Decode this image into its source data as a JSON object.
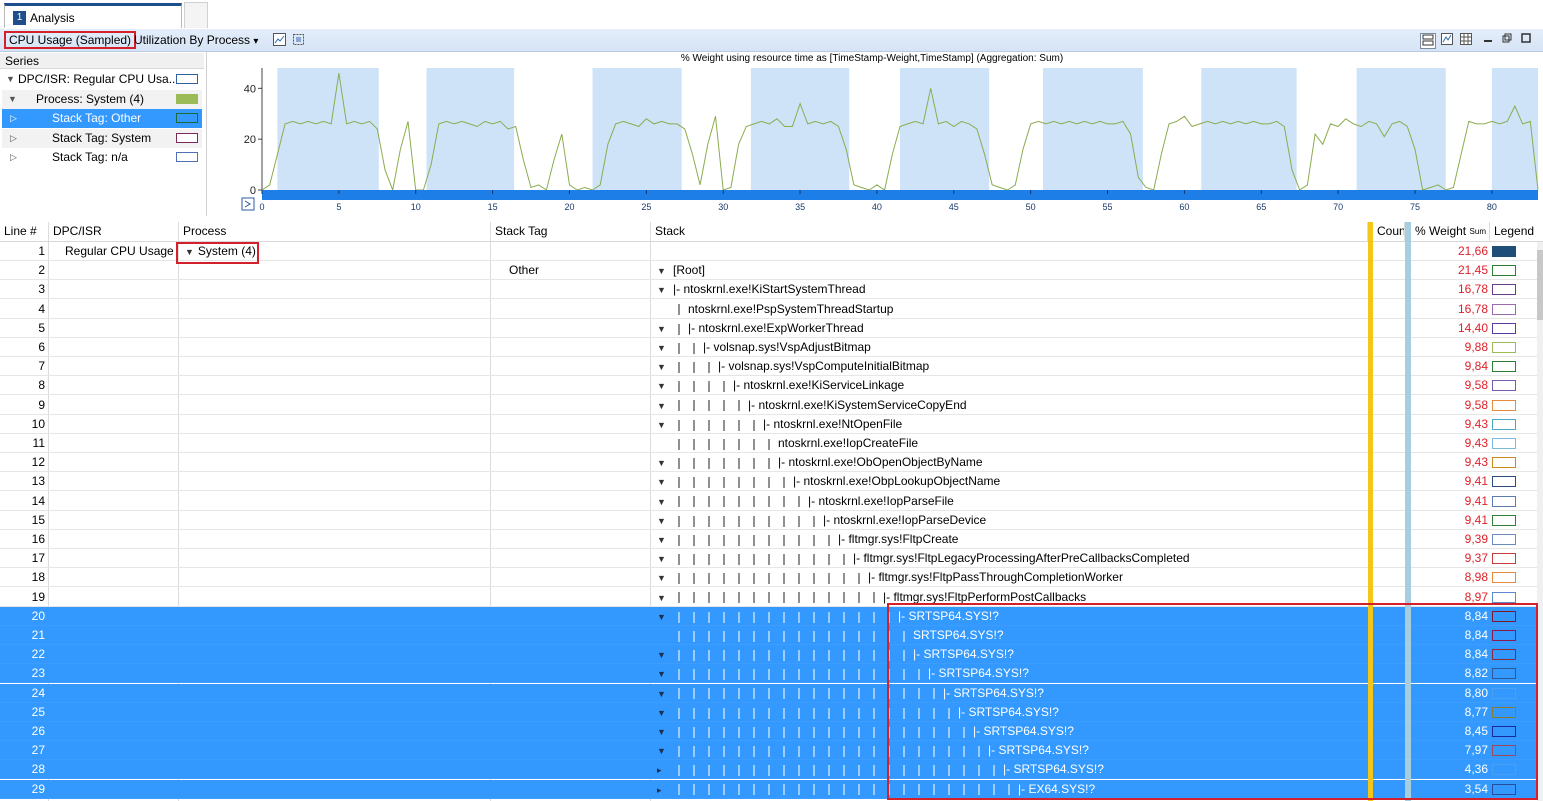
{
  "tabs": [
    {
      "number": "1",
      "label": "Analysis"
    }
  ],
  "toolbar": {
    "graph_title": "CPU Usage (Sampled)",
    "preset_dropdown": "Utilization By Process",
    "dropdown_caret": "▾"
  },
  "series": {
    "header": "Series",
    "items": [
      {
        "label": "DPC/ISR: Regular CPU Usa...",
        "swatch": "#ffffff",
        "swatch_border": "#3060a0",
        "expanded": true,
        "level": 0,
        "selected": false
      },
      {
        "label": "Process: System (4)",
        "swatch": "#9bbb59",
        "swatch_border": "#9bbb59",
        "expanded": true,
        "level": 1,
        "selected": false
      },
      {
        "label": "Stack Tag: Other",
        "swatch": "#3399ff",
        "swatch_border": "#1a6a3a",
        "expanded": false,
        "level": 2,
        "selected": true
      },
      {
        "label": "Stack Tag: System",
        "swatch": "#ffffff",
        "swatch_border": "#7a2a5a",
        "expanded": false,
        "level": 2,
        "selected": false
      },
      {
        "label": "Stack Tag: n/a",
        "swatch": "#ffffff",
        "swatch_border": "#5070b0",
        "expanded": false,
        "level": 2,
        "selected": false
      }
    ]
  },
  "chart_data": {
    "type": "line",
    "title": "% Weight using resource time as [TimeStamp-Weight,TimeStamp] (Aggregation: Sum)",
    "xlim": [
      0,
      83
    ],
    "ylim": [
      0,
      48
    ],
    "x_ticks": [
      0,
      5,
      10,
      15,
      20,
      25,
      30,
      35,
      40,
      45,
      50,
      55,
      60,
      65,
      70,
      75,
      80
    ],
    "y_ticks": [
      0,
      20,
      40
    ],
    "shaded_intervals": [
      [
        1,
        7.6
      ],
      [
        10.7,
        16.4
      ],
      [
        21.5,
        27.3
      ],
      [
        31.8,
        38.2
      ],
      [
        41.5,
        47.3
      ],
      [
        50.8,
        57.3
      ],
      [
        61.1,
        67.3
      ],
      [
        71.2,
        77
      ],
      [
        80,
        83
      ]
    ],
    "series": [
      {
        "color": "#8aac4f",
        "x": [
          0,
          0.5,
          1,
          1.5,
          2,
          2.5,
          3,
          3.5,
          4,
          4.5,
          5,
          5.5,
          6,
          6.5,
          7,
          7.5,
          8,
          8.5,
          9,
          9.5,
          10,
          10.5,
          11,
          11.5,
          12,
          12.5,
          13,
          13.5,
          14,
          14.5,
          15,
          15.5,
          16,
          16.5,
          17,
          17.5,
          18,
          18.5,
          19,
          19.5,
          20,
          20.5,
          21,
          21.5,
          22,
          22.5,
          23,
          23.5,
          24,
          24.5,
          25,
          25.5,
          26,
          26.5,
          27,
          27.5,
          28,
          28.5,
          29,
          29.5,
          30,
          30.5,
          31,
          31.5,
          32,
          32.5,
          33,
          33.5,
          34,
          34.5,
          35,
          35.5,
          36,
          36.5,
          37,
          37.5,
          38,
          38.5,
          39,
          39.5,
          40,
          40.5,
          41,
          41.5,
          42,
          42.5,
          43,
          43.5,
          44,
          44.5,
          45,
          45.5,
          46,
          46.5,
          47,
          47.5,
          48,
          48.5,
          49,
          49.5,
          50,
          50.5,
          51,
          51.5,
          52,
          52.5,
          53,
          53.5,
          54,
          54.5,
          55,
          55.5,
          56,
          56.5,
          57,
          57.5,
          58,
          58.5,
          59,
          59.5,
          60,
          60.5,
          61,
          61.5,
          62,
          62.5,
          63,
          63.5,
          64,
          64.5,
          65,
          65.5,
          66,
          66.5,
          67,
          67.5,
          68,
          68.5,
          69,
          69.5,
          70,
          70.5,
          71,
          71.5,
          72,
          72.5,
          73,
          73.5,
          74,
          74.5,
          75,
          75.5,
          76,
          76.5,
          77,
          77.5,
          78,
          78.5,
          79,
          79.5,
          80,
          80.5,
          81,
          81.5,
          82,
          82.5,
          83
        ],
        "y": [
          0,
          2,
          14,
          26,
          27,
          26,
          27,
          26,
          27,
          26,
          46,
          26,
          27,
          26,
          27,
          24,
          8,
          0,
          16,
          27,
          0,
          0,
          10,
          26,
          27,
          26,
          27,
          26,
          25,
          27,
          26,
          27,
          24,
          25,
          12,
          1,
          2,
          0,
          12,
          22,
          2,
          0,
          1,
          0,
          2,
          18,
          26,
          27,
          26,
          25,
          28,
          26,
          27,
          26,
          26,
          24,
          14,
          2,
          18,
          29,
          0,
          1,
          18,
          25,
          26,
          27,
          26,
          28,
          25,
          25,
          34,
          26,
          27,
          26,
          27,
          25,
          16,
          2,
          1,
          0,
          2,
          0,
          14,
          25,
          26,
          27,
          26,
          40,
          26,
          27,
          25,
          27,
          26,
          24,
          14,
          2,
          1,
          0,
          2,
          16,
          26,
          27,
          26,
          27,
          26,
          27,
          26,
          27,
          26,
          27,
          26,
          26,
          27,
          22,
          5,
          1,
          0,
          14,
          26,
          27,
          29,
          25,
          26,
          27,
          26,
          27,
          26,
          27,
          26,
          27,
          26,
          26,
          27,
          25,
          8,
          0,
          2,
          22,
          18,
          26,
          25,
          28,
          26,
          25,
          27,
          26,
          21,
          26,
          27,
          25,
          16,
          0,
          1,
          2,
          0,
          1,
          14,
          27,
          26,
          26,
          27,
          26,
          27,
          33,
          26,
          27,
          0
        ]
      }
    ]
  },
  "grid": {
    "columns": [
      "Line #",
      "DPC/ISR",
      "Process",
      "Stack Tag",
      "Stack",
      "Coun",
      "% Weight",
      "Legend"
    ],
    "weight_agg_label": "Sum",
    "rows": [
      {
        "line": "1",
        "dpc": "Regular CPU Usage",
        "process": "System (4)",
        "tag": "",
        "depth": -1,
        "expander": "",
        "stack": "",
        "weight": "21,66",
        "legend": "#1f4e79",
        "legend_border": "#1f4e79",
        "selected": false
      },
      {
        "line": "2",
        "dpc": "",
        "process": "",
        "tag": "Other",
        "depth": 0,
        "expander": "▼",
        "stack": "[Root]",
        "weight": "21,45",
        "legend": "#ffffff",
        "legend_border": "#2e7d32",
        "selected": false
      },
      {
        "line": "3",
        "dpc": "",
        "process": "",
        "tag": "",
        "depth": 0,
        "expander": "▼",
        "stack": "|- ntoskrnl.exe!KiStartSystemThread",
        "weight": "16,78",
        "legend": "#ffffff",
        "legend_border": "#6a3a8a",
        "selected": false
      },
      {
        "line": "4",
        "dpc": "",
        "process": "",
        "tag": "",
        "depth": 1,
        "expander": "",
        "stack": "ntoskrnl.exe!PspSystemThreadStartup",
        "weight": "16,78",
        "legend": "#ffffff",
        "legend_border": "#9c6ab0",
        "selected": false
      },
      {
        "line": "5",
        "dpc": "",
        "process": "",
        "tag": "",
        "depth": 1,
        "expander": "▼",
        "stack": "|- ntoskrnl.exe!ExpWorkerThread",
        "weight": "14,40",
        "legend": "#ffffff",
        "legend_border": "#5a3aa0",
        "selected": false
      },
      {
        "line": "6",
        "dpc": "",
        "process": "",
        "tag": "",
        "depth": 2,
        "expander": "▼",
        "stack": "|- volsnap.sys!VspAdjustBitmap",
        "weight": "9,88",
        "legend": "#ffffff",
        "legend_border": "#9bbb59",
        "selected": false
      },
      {
        "line": "7",
        "dpc": "",
        "process": "",
        "tag": "",
        "depth": 3,
        "expander": "▼",
        "stack": "|- volsnap.sys!VspComputeInitialBitmap",
        "weight": "9,84",
        "legend": "#ffffff",
        "legend_border": "#2e7d32",
        "selected": false
      },
      {
        "line": "8",
        "dpc": "",
        "process": "",
        "tag": "",
        "depth": 4,
        "expander": "▼",
        "stack": "|- ntoskrnl.exe!KiServiceLinkage",
        "weight": "9,58",
        "legend": "#ffffff",
        "legend_border": "#7a5ab0",
        "selected": false
      },
      {
        "line": "9",
        "dpc": "",
        "process": "",
        "tag": "",
        "depth": 5,
        "expander": "▼",
        "stack": "|- ntoskrnl.exe!KiSystemServiceCopyEnd",
        "weight": "9,58",
        "legend": "#ffffff",
        "legend_border": "#e8883a",
        "selected": false
      },
      {
        "line": "10",
        "dpc": "",
        "process": "",
        "tag": "",
        "depth": 6,
        "expander": "▼",
        "stack": "|- ntoskrnl.exe!NtOpenFile",
        "weight": "9,43",
        "legend": "#ffffff",
        "legend_border": "#4aa8c8",
        "selected": false
      },
      {
        "line": "11",
        "dpc": "",
        "process": "",
        "tag": "",
        "depth": 7,
        "expander": "",
        "stack": "ntoskrnl.exe!IopCreateFile",
        "weight": "9,43",
        "legend": "#ffffff",
        "legend_border": "#7ab8e0",
        "selected": false
      },
      {
        "line": "12",
        "dpc": "",
        "process": "",
        "tag": "",
        "depth": 7,
        "expander": "▼",
        "stack": "|- ntoskrnl.exe!ObOpenObjectByName",
        "weight": "9,43",
        "legend": "#ffffff",
        "legend_border": "#c88a1a",
        "selected": false
      },
      {
        "line": "13",
        "dpc": "",
        "process": "",
        "tag": "",
        "depth": 8,
        "expander": "▼",
        "stack": "|- ntoskrnl.exe!ObpLookupObjectName",
        "weight": "9,41",
        "legend": "#ffffff",
        "legend_border": "#2a4a80",
        "selected": false
      },
      {
        "line": "14",
        "dpc": "",
        "process": "",
        "tag": "",
        "depth": 9,
        "expander": "▼",
        "stack": "|- ntoskrnl.exe!IopParseFile",
        "weight": "9,41",
        "legend": "#ffffff",
        "legend_border": "#5a7ab0",
        "selected": false
      },
      {
        "line": "15",
        "dpc": "",
        "process": "",
        "tag": "",
        "depth": 10,
        "expander": "▼",
        "stack": "|- ntoskrnl.exe!IopParseDevice",
        "weight": "9,41",
        "legend": "#ffffff",
        "legend_border": "#2e7d32",
        "selected": false
      },
      {
        "line": "16",
        "dpc": "",
        "process": "",
        "tag": "",
        "depth": 11,
        "expander": "▼",
        "stack": "|- fltmgr.sys!FltpCreate",
        "weight": "9,39",
        "legend": "#ffffff",
        "legend_border": "#6a8ac0",
        "selected": false
      },
      {
        "line": "17",
        "dpc": "",
        "process": "",
        "tag": "",
        "depth": 12,
        "expander": "▼",
        "stack": "|- fltmgr.sys!FltpLegacyProcessingAfterPreCallbacksCompleted",
        "weight": "9,37",
        "legend": "#ffffff",
        "legend_border": "#c83a3a",
        "selected": false
      },
      {
        "line": "18",
        "dpc": "",
        "process": "",
        "tag": "",
        "depth": 13,
        "expander": "▼",
        "stack": "|- fltmgr.sys!FltpPassThroughCompletionWorker",
        "weight": "8,98",
        "legend": "#ffffff",
        "legend_border": "#e8883a",
        "selected": false
      },
      {
        "line": "19",
        "dpc": "",
        "process": "",
        "tag": "",
        "depth": 14,
        "expander": "▼",
        "stack": "|- fltmgr.sys!FltpPerformPostCallbacks",
        "weight": "8,97",
        "legend": "#ffffff",
        "legend_border": "#5a8ad0",
        "selected": false
      },
      {
        "line": "20",
        "dpc": "",
        "process": "",
        "tag": "",
        "depth": 15,
        "expander": "▼",
        "stack": "|- SRTSP64.SYS!?",
        "weight": "8,84",
        "legend": "#3399ff",
        "legend_border": "#7a1a2a",
        "selected": true
      },
      {
        "line": "21",
        "dpc": "",
        "process": "",
        "tag": "",
        "depth": 16,
        "expander": "",
        "stack": "SRTSP64.SYS!?",
        "weight": "8,84",
        "legend": "#3399ff",
        "legend_border": "#8a1a4a",
        "selected": true
      },
      {
        "line": "22",
        "dpc": "",
        "process": "",
        "tag": "",
        "depth": 16,
        "expander": "▼",
        "stack": "|- SRTSP64.SYS!?",
        "weight": "8,84",
        "legend": "#3399ff",
        "legend_border": "#8a2a3a",
        "selected": true
      },
      {
        "line": "23",
        "dpc": "",
        "process": "",
        "tag": "",
        "depth": 17,
        "expander": "▼",
        "stack": "|- SRTSP64.SYS!?",
        "weight": "8,82",
        "legend": "#3399ff",
        "legend_border": "#2a5a9a",
        "selected": true
      },
      {
        "line": "24",
        "dpc": "",
        "process": "",
        "tag": "",
        "depth": 18,
        "expander": "▼",
        "stack": "|- SRTSP64.SYS!?",
        "weight": "8,80",
        "legend": "#3399ff",
        "legend_border": "#4aa0f0",
        "selected": true
      },
      {
        "line": "25",
        "dpc": "",
        "process": "",
        "tag": "",
        "depth": 19,
        "expander": "▼",
        "stack": "|- SRTSP64.SYS!?",
        "weight": "8,77",
        "legend": "#3399ff",
        "legend_border": "#8a7a3a",
        "selected": true
      },
      {
        "line": "26",
        "dpc": "",
        "process": "",
        "tag": "",
        "depth": 20,
        "expander": "▼",
        "stack": "|- SRTSP64.SYS!?",
        "weight": "8,45",
        "legend": "#3399ff",
        "legend_border": "#1a2a9a",
        "selected": true
      },
      {
        "line": "27",
        "dpc": "",
        "process": "",
        "tag": "",
        "depth": 21,
        "expander": "▼",
        "stack": "|- SRTSP64.SYS!?",
        "weight": "7,97",
        "legend": "#3399ff",
        "legend_border": "#9a4a5a",
        "selected": true
      },
      {
        "line": "28",
        "dpc": "",
        "process": "",
        "tag": "",
        "depth": 22,
        "expander": "▸",
        "stack": "|- SRTSP64.SYS!?",
        "weight": "4,36",
        "legend": "#3399ff",
        "legend_border": "#4aa0f0",
        "selected": true
      },
      {
        "line": "29",
        "dpc": "",
        "process": "",
        "tag": "",
        "depth": 23,
        "expander": "▸",
        "stack": "|- EX64.SYS!?",
        "weight": "3,54",
        "legend": "#3399ff",
        "legend_border": "#2a4a9a",
        "selected": true
      }
    ]
  }
}
